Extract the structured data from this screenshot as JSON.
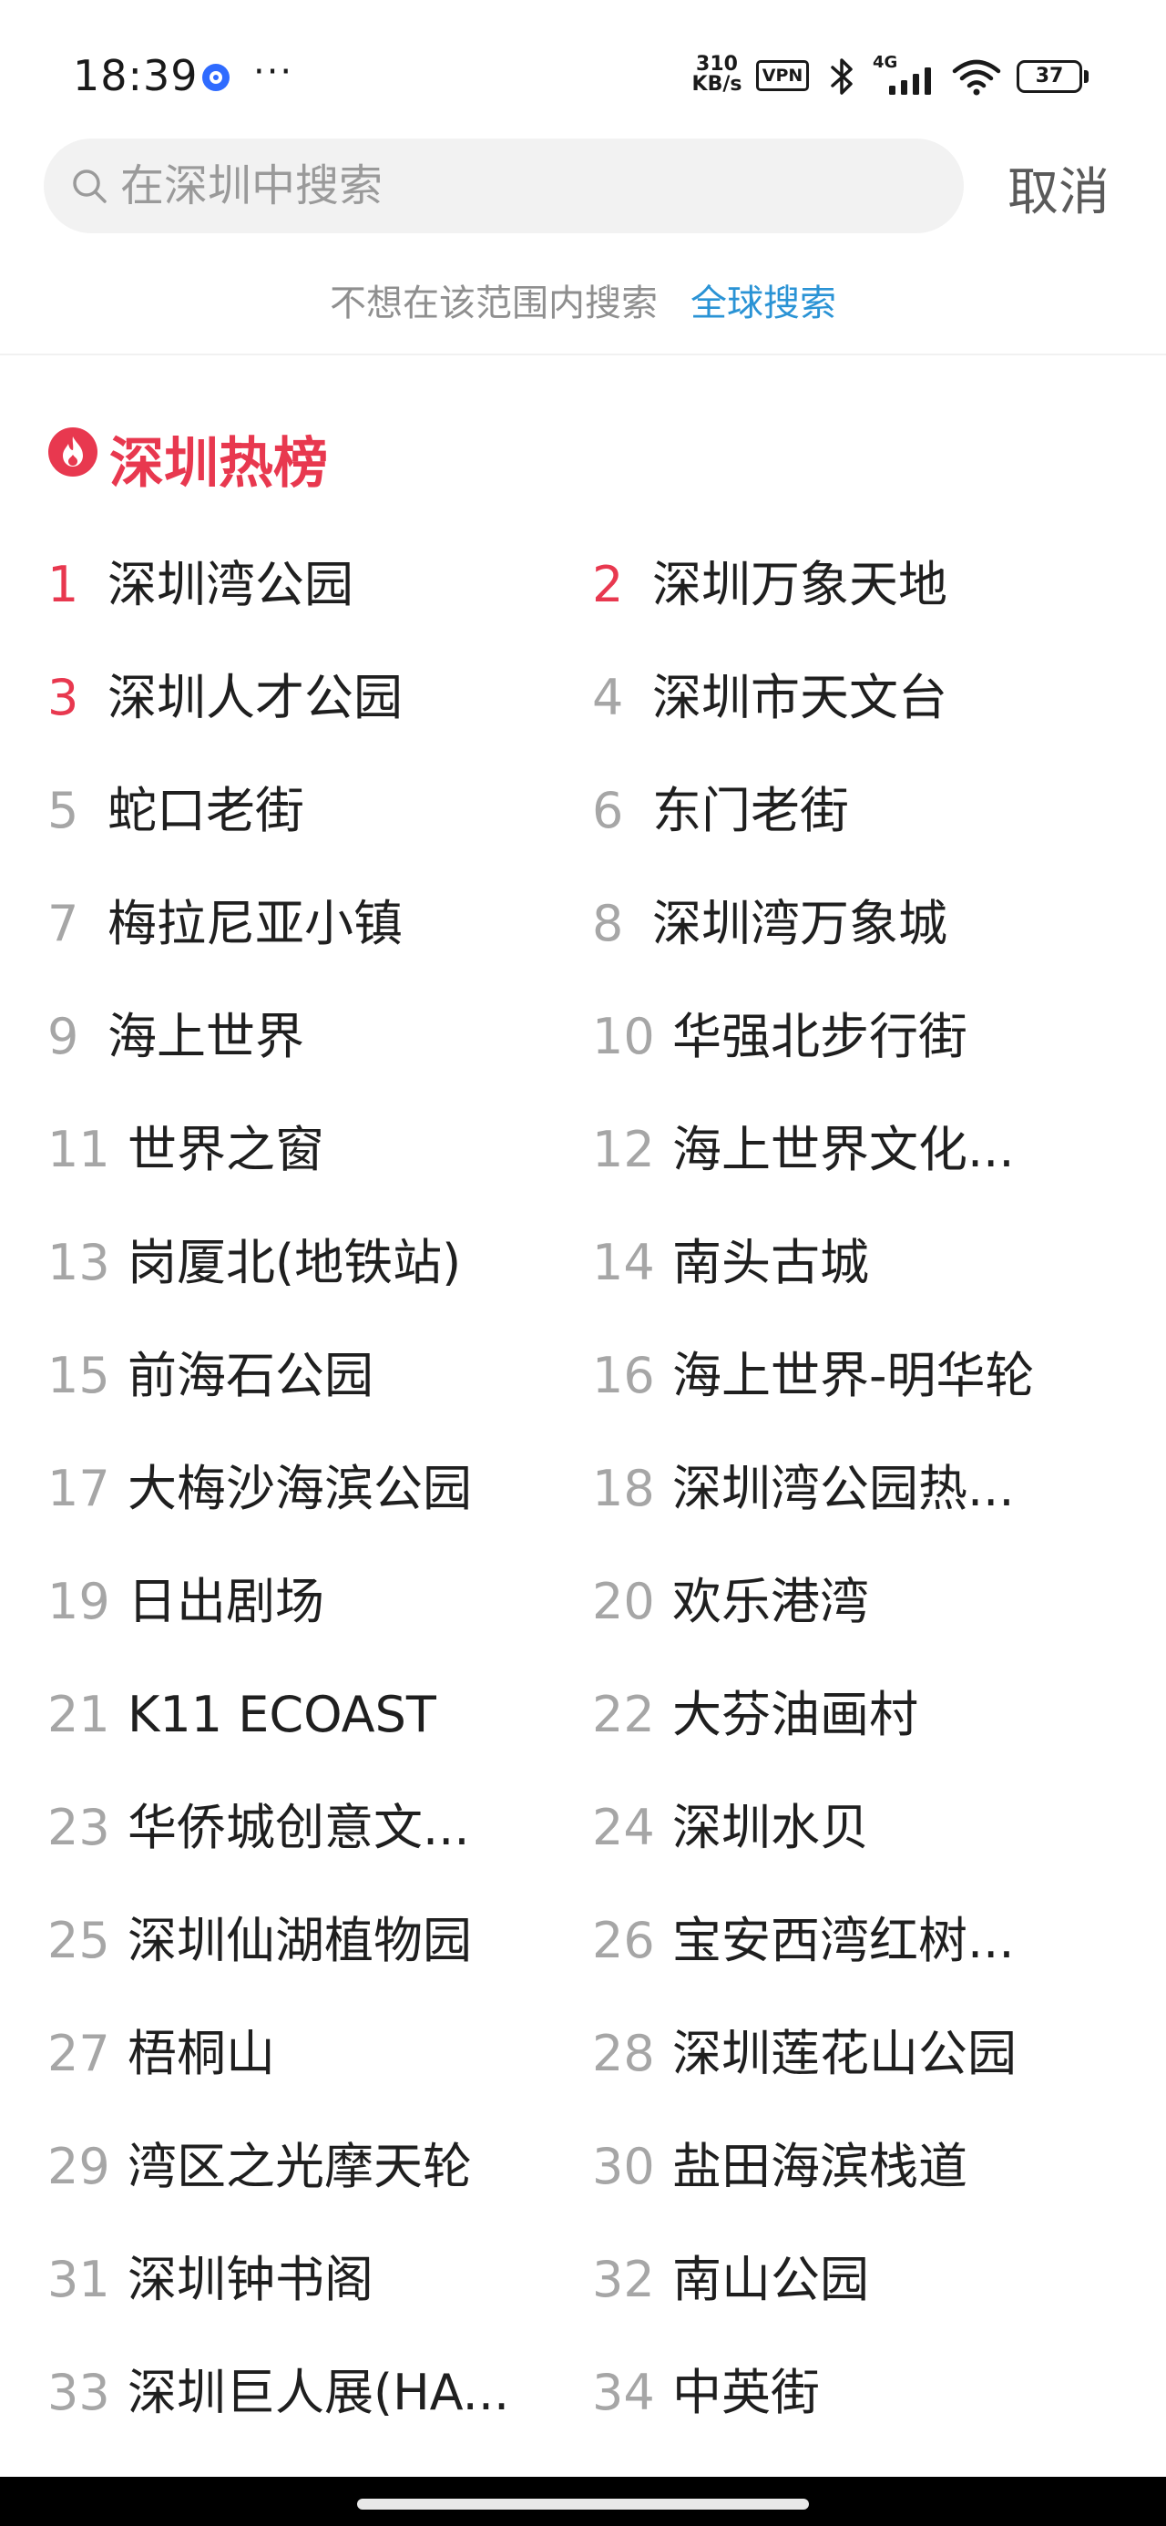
{
  "status_bar": {
    "time": "18:39",
    "more": "···",
    "speed_value": "310",
    "speed_unit": "KB/s",
    "vpn": "VPN",
    "network": "4G",
    "battery": "37",
    "icons": [
      "app-notification-icon",
      "bluetooth-icon",
      "signal-icon",
      "wifi-icon",
      "battery-icon"
    ]
  },
  "search": {
    "placeholder": "在深圳中搜索",
    "value": "",
    "cancel_label": "取消"
  },
  "scope": {
    "hint": "不想在该范围内搜索",
    "link": "全球搜索"
  },
  "hot_list": {
    "title": "深圳热榜",
    "icon": "fire-icon",
    "accent_color": "#e8384f",
    "items": [
      {
        "rank": "1",
        "name": "深圳湾公园"
      },
      {
        "rank": "2",
        "name": "深圳万象天地"
      },
      {
        "rank": "3",
        "name": "深圳人才公园"
      },
      {
        "rank": "4",
        "name": "深圳市天文台"
      },
      {
        "rank": "5",
        "name": "蛇口老街"
      },
      {
        "rank": "6",
        "name": "东门老街"
      },
      {
        "rank": "7",
        "name": "梅拉尼亚小镇"
      },
      {
        "rank": "8",
        "name": "深圳湾万象城"
      },
      {
        "rank": "9",
        "name": "海上世界"
      },
      {
        "rank": "10",
        "name": "华强北步行街"
      },
      {
        "rank": "11",
        "name": "世界之窗"
      },
      {
        "rank": "12",
        "name": "海上世界文化..."
      },
      {
        "rank": "13",
        "name": "岗厦北(地铁站)"
      },
      {
        "rank": "14",
        "name": "南头古城"
      },
      {
        "rank": "15",
        "name": "前海石公园"
      },
      {
        "rank": "16",
        "name": "海上世界-明华轮"
      },
      {
        "rank": "17",
        "name": "大梅沙海滨公园"
      },
      {
        "rank": "18",
        "name": "深圳湾公园热..."
      },
      {
        "rank": "19",
        "name": "日出剧场"
      },
      {
        "rank": "20",
        "name": "欢乐港湾"
      },
      {
        "rank": "21",
        "name": "K11 ECOAST"
      },
      {
        "rank": "22",
        "name": "大芬油画村"
      },
      {
        "rank": "23",
        "name": "华侨城创意文..."
      },
      {
        "rank": "24",
        "name": "深圳水贝"
      },
      {
        "rank": "25",
        "name": "深圳仙湖植物园"
      },
      {
        "rank": "26",
        "name": "宝安西湾红树..."
      },
      {
        "rank": "27",
        "name": "梧桐山"
      },
      {
        "rank": "28",
        "name": "深圳莲花山公园"
      },
      {
        "rank": "29",
        "name": "湾区之光摩天轮"
      },
      {
        "rank": "30",
        "name": "盐田海滨栈道"
      },
      {
        "rank": "31",
        "name": "深圳钟书阁"
      },
      {
        "rank": "32",
        "name": "南山公园"
      },
      {
        "rank": "33",
        "name": "深圳巨人展(HA..."
      },
      {
        "rank": "34",
        "name": "中英街"
      }
    ]
  }
}
